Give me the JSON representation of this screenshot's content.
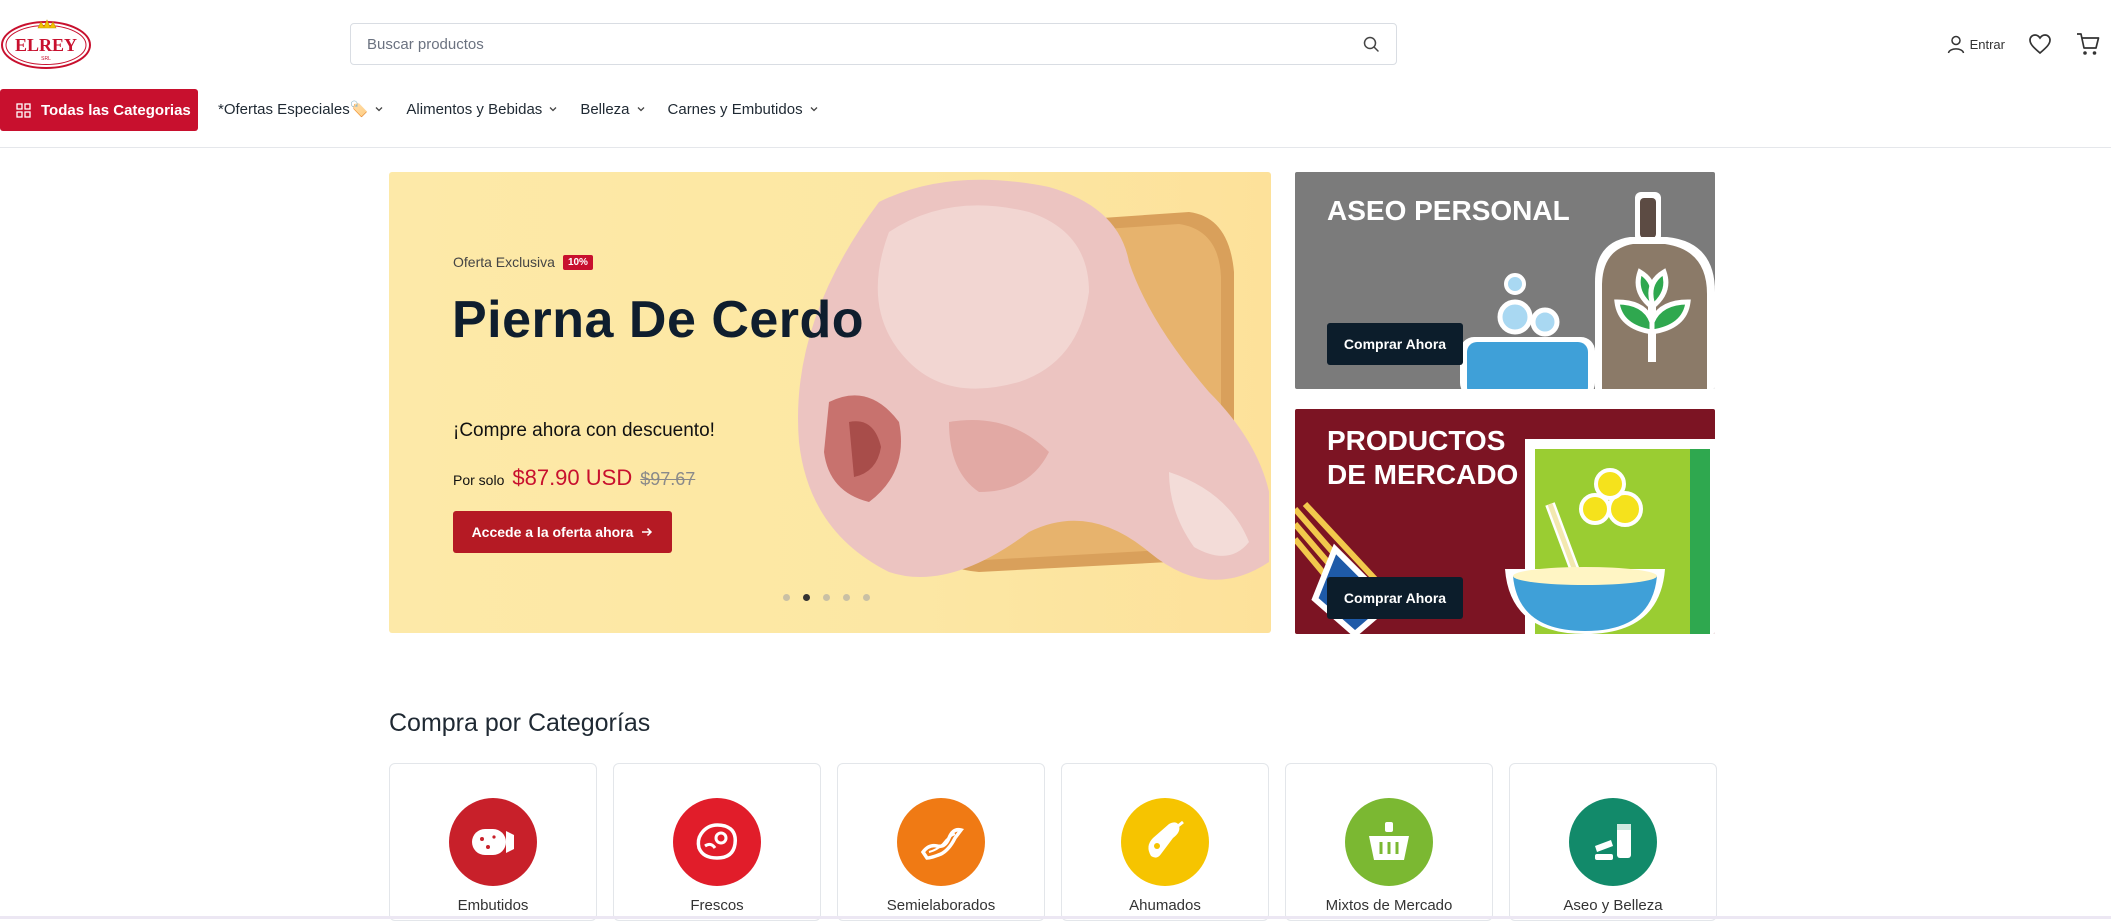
{
  "brand": {
    "logo_text": "ELREY",
    "logo_sub": "SRL",
    "accent": "#c8102e"
  },
  "search": {
    "placeholder": "Buscar productos",
    "icon": "search-icon"
  },
  "header_tools": {
    "login_label": "Entrar",
    "wishlist_icon": "heart-icon",
    "cart_icon": "cart-icon"
  },
  "nav": {
    "all_categories_label": "Todas las Categorias",
    "items": [
      {
        "label": "*Ofertas Especiales🏷️"
      },
      {
        "label": "Alimentos y Bebidas"
      },
      {
        "label": "Belleza"
      },
      {
        "label": "Carnes y Embutidos"
      }
    ]
  },
  "hero": {
    "offer_label": "Oferta Exclusiva",
    "discount_badge": "10%",
    "title": "Pierna De Cerdo",
    "subtitle": "¡Compre ahora con descuento!",
    "price_label": "Por solo",
    "price_now": "$87.90 USD",
    "price_old": "$97.67",
    "cta_label": "Accede a la oferta ahora",
    "slides": 5,
    "active_slide": 2
  },
  "promos": [
    {
      "title": "ASEO PERSONAL",
      "cta": "Comprar Ahora",
      "bg": "#7b7b7b"
    },
    {
      "title": "PRODUCTOS DE MERCADO",
      "cta": "Comprar Ahora",
      "bg": "#7c1423"
    }
  ],
  "categories_section": {
    "title": "Compra por Categorías",
    "items": [
      {
        "label": "Embutidos",
        "color": "#c8202a",
        "icon": "sausage-icon"
      },
      {
        "label": "Frescos",
        "color": "#e11d2a",
        "icon": "steak-icon"
      },
      {
        "label": "Semielaborados",
        "color": "#f07a14",
        "icon": "bacon-icon"
      },
      {
        "label": "Ahumados",
        "color": "#f6c400",
        "icon": "ham-leg-icon"
      },
      {
        "label": "Mixtos de Mercado",
        "color": "#7bb832",
        "icon": "basket-icon"
      },
      {
        "label": "Aseo y Belleza",
        "color": "#128a6a",
        "icon": "cosmetics-icon"
      }
    ]
  }
}
